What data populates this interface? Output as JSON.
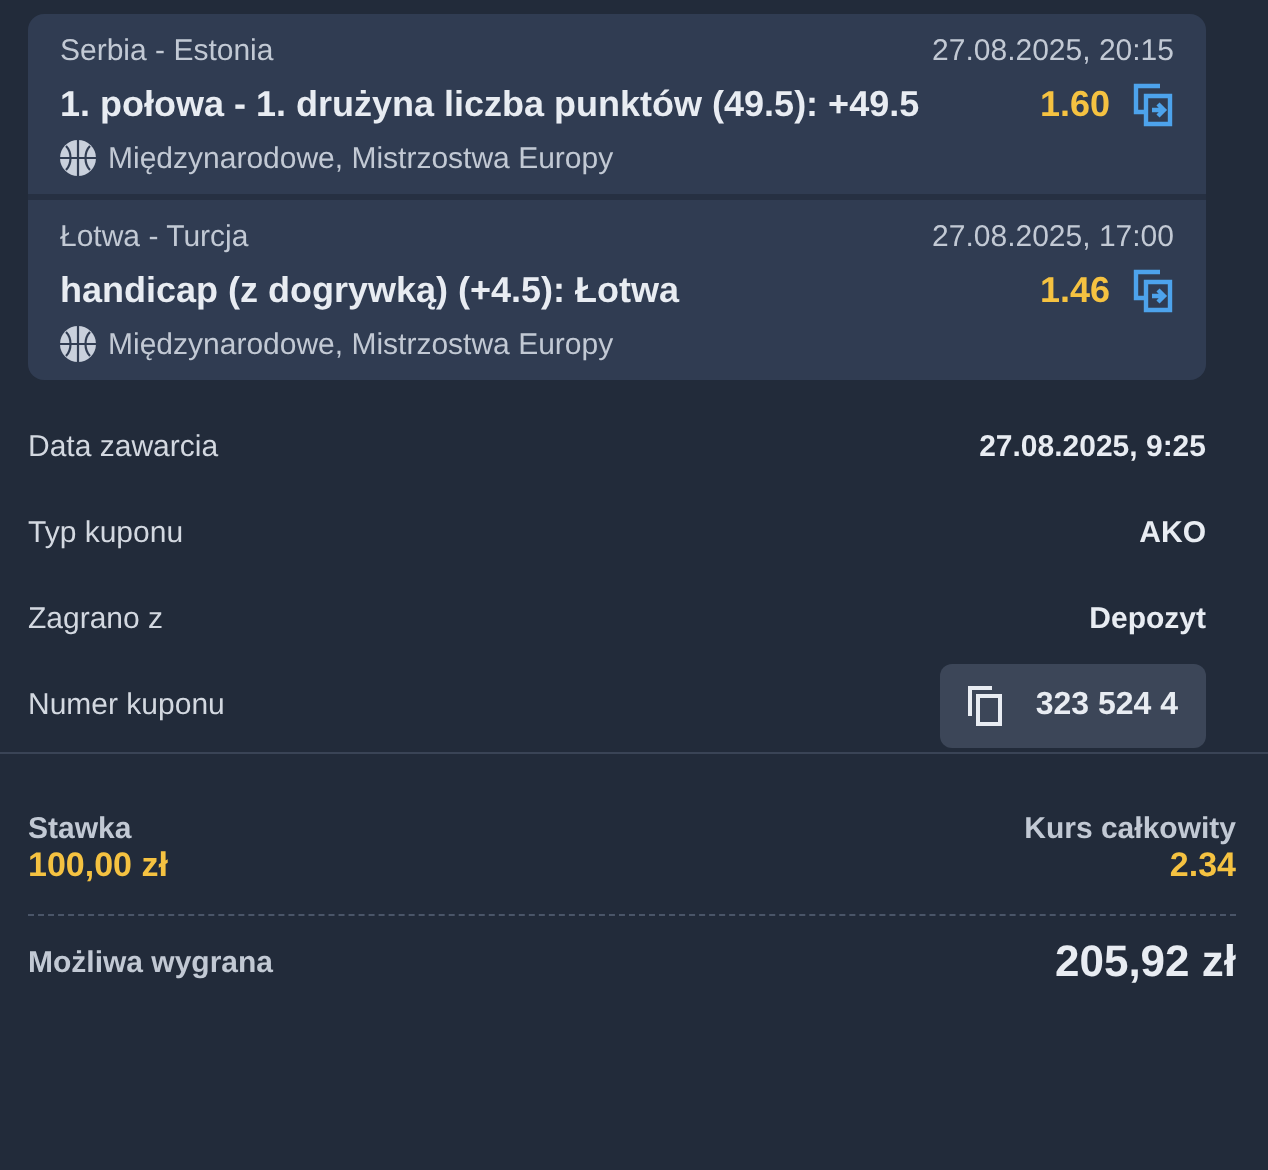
{
  "selections": [
    {
      "match": "Serbia - Estonia",
      "datetime": "27.08.2025, 20:15",
      "market": "1. połowa - 1. drużyna liczba punktów (49.5): +49.5",
      "odds": "1.60",
      "competition": "Międzynarodowe, Mistrzostwa Europy"
    },
    {
      "match": "Łotwa - Turcja",
      "datetime": "27.08.2025, 17:00",
      "market": "handicap (z dogrywką) (+4.5): Łotwa",
      "odds": "1.46",
      "competition": "Międzynarodowe, Mistrzostwa Europy"
    }
  ],
  "details": [
    {
      "label": "Data zawarcia",
      "value": "27.08.2025, 9:25",
      "kind": "text"
    },
    {
      "label": "Typ kuponu",
      "value": "AKO",
      "kind": "text"
    },
    {
      "label": "Zagrano z",
      "value": "Depozyt",
      "kind": "text"
    },
    {
      "label": "Numer kuponu",
      "value": "323 524 4",
      "kind": "copy"
    }
  ],
  "stake": {
    "label": "Stawka",
    "value": "100,00 zł"
  },
  "total_odds": {
    "label": "Kurs całkowity",
    "value": "2.34"
  },
  "possible_win": {
    "label": "Możliwa wygrana",
    "value": "205,92 zł"
  }
}
